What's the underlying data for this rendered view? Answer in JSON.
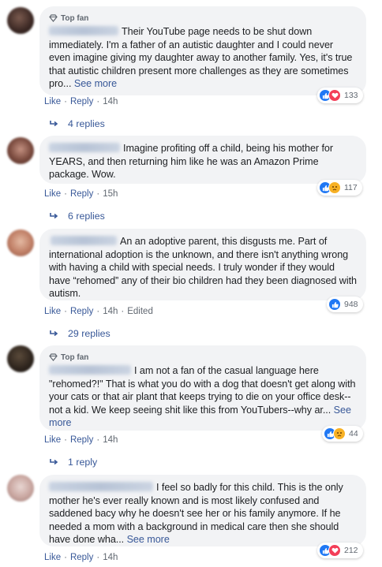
{
  "comments": [
    {
      "top_fan": "Top fan",
      "text": "Their YouTube page needs to be shut down immediately. I'm a father of an autistic daughter and I could never even imagine giving my daughter away to another family. Yes, it's true that autistic children present more challenges as they are sometimes pro...",
      "see_more": "See more",
      "like": "Like",
      "reply": "Reply",
      "time": "14h",
      "edited": "",
      "reaction_count": "133",
      "reactions": [
        "like",
        "love"
      ],
      "replies_label": "4 replies"
    },
    {
      "top_fan": "",
      "text": "Imagine profiting off a child, being his mother for YEARS, and then returning him like he was an Amazon Prime package. Wow.",
      "see_more": "",
      "like": "Like",
      "reply": "Reply",
      "time": "15h",
      "edited": "",
      "reaction_count": "117",
      "reactions": [
        "like",
        "sad"
      ],
      "replies_label": "6 replies"
    },
    {
      "top_fan": "",
      "text": "An an adoptive parent, this disgusts me. Part of international adoption is the unknown, and there isn't anything wrong with having a child with special needs. I truly wonder if they would have “rehomed” any of their bio children had they been diagnosed with autism.",
      "see_more": "",
      "like": "Like",
      "reply": "Reply",
      "time": "14h",
      "edited": "Edited",
      "reaction_count": "948",
      "reactions": [
        "like"
      ],
      "replies_label": "29 replies"
    },
    {
      "top_fan": "Top fan",
      "text": "I am not a fan of the casual language here \"rehomed?!\" That is what you do with a dog that doesn't get along with your cats or that air plant that keeps trying to die on your office desk-- not a kid. We keep seeing shit like this from YouTubers--why ar...",
      "see_more": "See more",
      "like": "Like",
      "reply": "Reply",
      "time": "14h",
      "edited": "",
      "reaction_count": "44",
      "reactions": [
        "like",
        "sad"
      ],
      "replies_label": "1 reply"
    },
    {
      "top_fan": "",
      "text": "I feel so badly for this child. This is the only mother he's ever really known and is most likely confused and saddened bacy why he doesn't see her or his family anymore. If he needed a mom with a background in medical care then she should have done wha...",
      "see_more": "See more",
      "like": "Like",
      "reply": "Reply",
      "time": "14h",
      "edited": "",
      "reaction_count": "212",
      "reactions": [
        "like",
        "love"
      ],
      "replies_label": ""
    }
  ],
  "colors": {
    "link": "#385898",
    "meta": "#606770",
    "bubble": "#f2f3f5",
    "like": "#2078f4",
    "love": "#f33e58",
    "sad": "#f7b125"
  }
}
